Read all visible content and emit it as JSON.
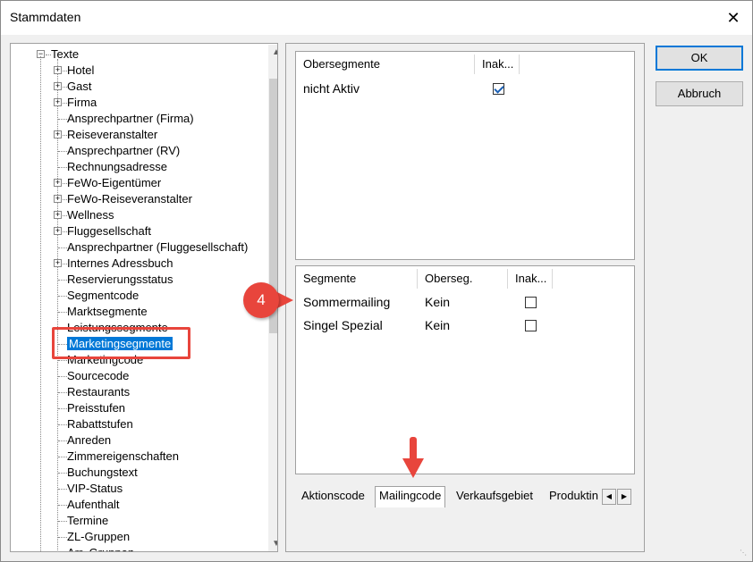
{
  "window": {
    "title": "Stammdaten",
    "close_glyph": "✕"
  },
  "tree": {
    "root": "Texte",
    "items": [
      {
        "label": "Hotel",
        "expandable": true
      },
      {
        "label": "Gast",
        "expandable": true
      },
      {
        "label": "Firma",
        "expandable": true
      },
      {
        "label": "Ansprechpartner (Firma)",
        "expandable": false
      },
      {
        "label": "Reiseveranstalter",
        "expandable": true
      },
      {
        "label": "Ansprechpartner (RV)",
        "expandable": false
      },
      {
        "label": "Rechnungsadresse",
        "expandable": false
      },
      {
        "label": "FeWo-Eigentümer",
        "expandable": true
      },
      {
        "label": "FeWo-Reiseveranstalter",
        "expandable": true
      },
      {
        "label": "Wellness",
        "expandable": true
      },
      {
        "label": "Fluggesellschaft",
        "expandable": true
      },
      {
        "label": "Ansprechpartner (Fluggesellschaft)",
        "expandable": false
      },
      {
        "label": "Internes Adressbuch",
        "expandable": true
      },
      {
        "label": "Reservierungsstatus",
        "expandable": false
      },
      {
        "label": "Segmentcode",
        "expandable": false
      },
      {
        "label": "Marktsegmente",
        "expandable": false
      },
      {
        "label": "Leistungssegmente",
        "expandable": false
      },
      {
        "label": "Marketingsegmente",
        "expandable": false,
        "selected": true
      },
      {
        "label": "Marketingcode",
        "expandable": false
      },
      {
        "label": "Sourcecode",
        "expandable": false
      },
      {
        "label": "Restaurants",
        "expandable": false
      },
      {
        "label": "Preisstufen",
        "expandable": false
      },
      {
        "label": "Rabattstufen",
        "expandable": false
      },
      {
        "label": "Anreden",
        "expandable": false
      },
      {
        "label": "Zimmereigenschaften",
        "expandable": false
      },
      {
        "label": "Buchungstext",
        "expandable": false
      },
      {
        "label": "VIP-Status",
        "expandable": false
      },
      {
        "label": "Aufenthalt",
        "expandable": false
      },
      {
        "label": "Termine",
        "expandable": false
      },
      {
        "label": "ZL-Gruppen",
        "expandable": false
      },
      {
        "label": "Arr.-Gruppen",
        "expandable": false
      }
    ]
  },
  "obersegmente": {
    "headers": [
      "Obersegmente",
      "Inak..."
    ],
    "rows": [
      {
        "name": "nicht Aktiv",
        "inaktiv": true
      }
    ]
  },
  "segmente": {
    "headers": [
      "Segmente",
      "Oberseg.",
      "Inak..."
    ],
    "rows": [
      {
        "name": "Sommermailing",
        "oberseg": "Kein",
        "inaktiv": false
      },
      {
        "name": "Singel Spezial",
        "oberseg": "Kein",
        "inaktiv": false
      }
    ]
  },
  "tabs": [
    "Aktionscode",
    "Mailingcode",
    "Verkaufsgebiet",
    "Produktin"
  ],
  "active_tab": "Mailingcode",
  "buttons": {
    "ok": "OK",
    "cancel": "Abbruch"
  },
  "annotation": {
    "step": "4"
  },
  "colors": {
    "accent": "#0078d7",
    "annotation_red": "#e8453c"
  }
}
